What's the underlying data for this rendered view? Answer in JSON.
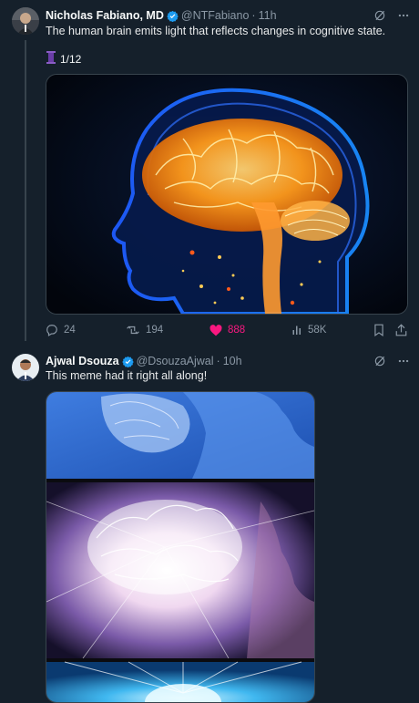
{
  "tweets": [
    {
      "name": "Nicholas Fabiano, MD",
      "handle": "@NTFabiano",
      "time": "11h",
      "text": "The human brain emits light that reflects changes in cognitive state.",
      "thread_label": "1/12",
      "stats": {
        "replies": "24",
        "reposts": "194",
        "likes": "888",
        "views": "58K"
      }
    },
    {
      "name": "Ajwal Dsouza",
      "handle": "@DsouzaAjwal",
      "time": "10h",
      "text": "This meme had it right all along!"
    }
  ],
  "colors": {
    "background": "#15202b",
    "verified": "#1d9bf0",
    "like_active": "#f91880",
    "muted": "#8b98a5"
  },
  "icons": [
    "verified-badge-icon",
    "grok-icon",
    "more-icon",
    "reply-icon",
    "repost-icon",
    "like-icon",
    "views-icon",
    "bookmark-icon",
    "share-icon",
    "thread-spool-icon"
  ]
}
